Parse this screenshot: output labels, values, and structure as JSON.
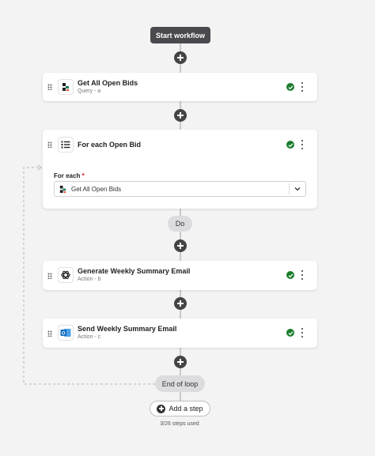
{
  "workflow": {
    "start_label": "Start workflow",
    "steps": [
      {
        "title": "Get All Open Bids",
        "subtitle": "Query - a",
        "icon": "query-app-icon",
        "status": "success"
      },
      {
        "title": "For each Open Bid",
        "subtitle": "",
        "icon": "list-icon",
        "status": "success"
      },
      {
        "title": "Generate Weekly Summary Email",
        "subtitle": "Action - b",
        "icon": "openai-icon",
        "status": "success"
      },
      {
        "title": "Send Weekly Summary Email",
        "subtitle": "Action - c",
        "icon": "outlook-icon",
        "status": "success"
      }
    ],
    "loop": {
      "for_each_label": "For each",
      "required_mark": "*",
      "selected_value": "Get All Open Bids",
      "do_label": "Do",
      "end_label": "End of loop"
    },
    "add_step_label": "Add a step",
    "usage_text": "3/26 steps used"
  },
  "colors": {
    "background": "#f3f3f4",
    "success": "#1a7d2c",
    "dark_button": "#4a4a4e",
    "outlook_blue": "#0f6cbd"
  }
}
